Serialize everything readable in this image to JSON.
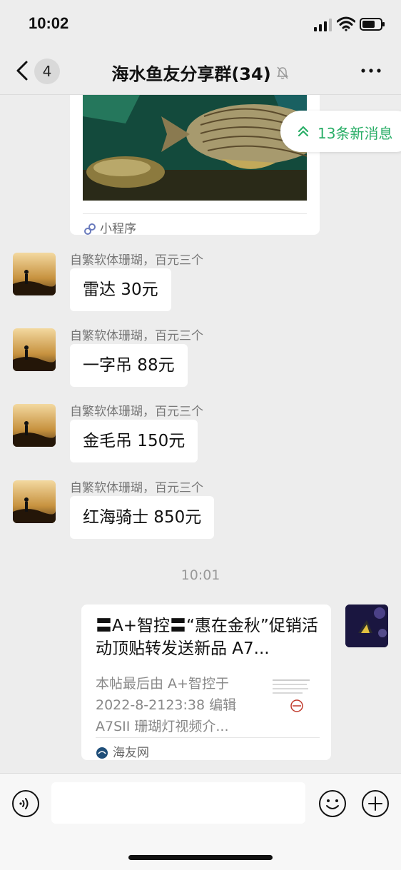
{
  "status_bar": {
    "time": "10:02"
  },
  "nav": {
    "unread_count": "4",
    "title": "海水鱼友分享群(34)"
  },
  "mini_program_card": {
    "source_label": "小程序"
  },
  "new_messages_pill": {
    "label": "13条新消息"
  },
  "messages": [
    {
      "sender": "自繁软体珊瑚，百元三个",
      "text": "雷达 30元"
    },
    {
      "sender": "自繁软体珊瑚，百元三个",
      "text": "一字吊 88元"
    },
    {
      "sender": "自繁软体珊瑚，百元三个",
      "text": "金毛吊 150元"
    },
    {
      "sender": "自繁软体珊瑚，百元三个",
      "text": "红海骑士 850元"
    }
  ],
  "timestamp": "10:01",
  "link_card": {
    "title": "〓A+智控〓“惠在金秋”促销活动顶贴转发送新品 A7...",
    "description": "本帖最后由 A+智控于 2022-8-2123:38 编辑 A7SII 珊瑚灯视频介...",
    "source": "海友网"
  },
  "input": {
    "placeholder": ""
  },
  "colors": {
    "accent_green": "#2aae67",
    "background": "#ededed"
  }
}
